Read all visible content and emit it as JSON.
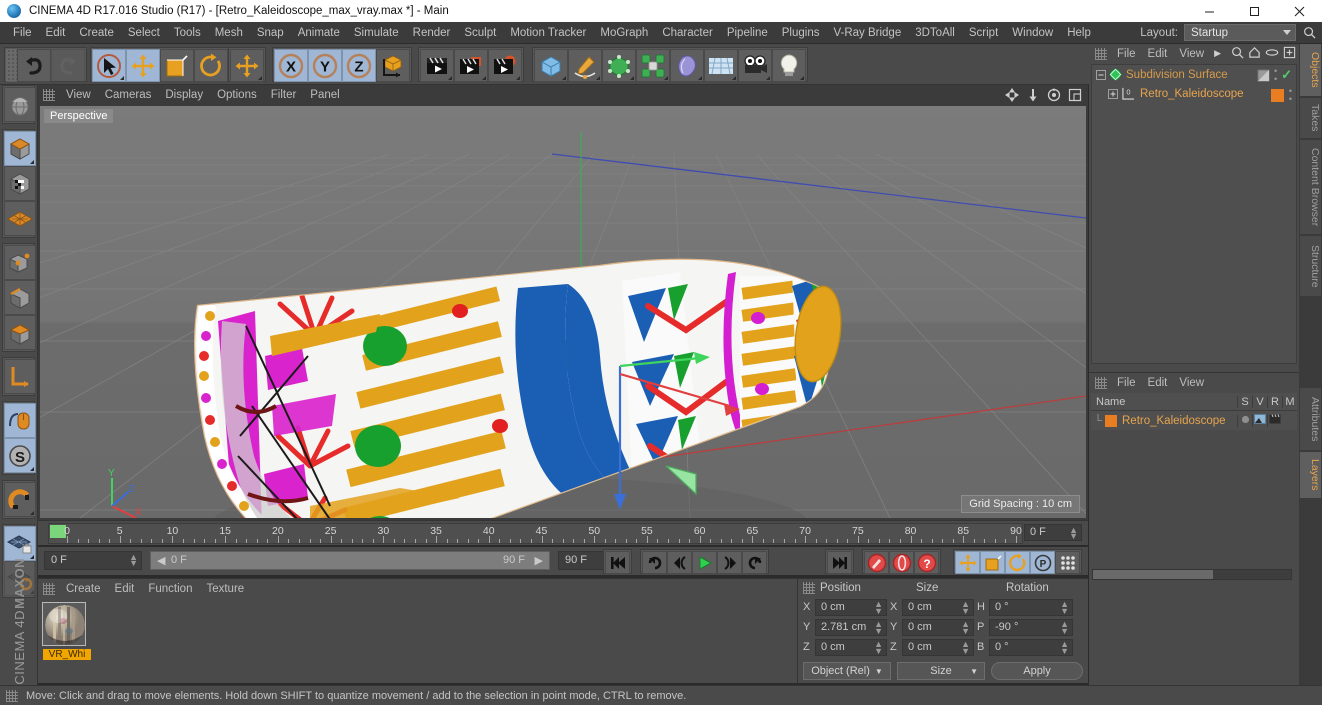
{
  "window": {
    "title": "CINEMA 4D R17.016 Studio (R17) - [Retro_Kaleidoscope_max_vray.max *] - Main",
    "app_icon": "c4d-logo-icon",
    "minimize": "—",
    "maximize": "❐",
    "close": "✕"
  },
  "menubar": {
    "items": [
      {
        "label": "File"
      },
      {
        "label": "Edit"
      },
      {
        "label": "Create"
      },
      {
        "label": "Select"
      },
      {
        "label": "Tools"
      },
      {
        "label": "Mesh"
      },
      {
        "label": "Snap"
      },
      {
        "label": "Animate"
      },
      {
        "label": "Simulate"
      },
      {
        "label": "Render"
      },
      {
        "label": "Sculpt"
      },
      {
        "label": "Motion Tracker"
      },
      {
        "label": "MoGraph"
      },
      {
        "label": "Character"
      },
      {
        "label": "Pipeline"
      },
      {
        "label": "Plugins"
      },
      {
        "label": "V-Ray Bridge"
      },
      {
        "label": "3DToAll"
      },
      {
        "label": "Script"
      },
      {
        "label": "Window"
      },
      {
        "label": "Help"
      }
    ],
    "layout_label": "Layout:",
    "layout_value": "Startup",
    "search_icon": "search-icon"
  },
  "toolbar": {
    "groups": [
      {
        "buttons": [
          {
            "name": "undo-button",
            "icon": "undo-arrow-icon",
            "state": "normal"
          },
          {
            "name": "redo-button",
            "icon": "redo-arrow-icon",
            "state": "disabled"
          }
        ]
      },
      {
        "buttons": [
          {
            "name": "live-selection-tool",
            "icon": "cursor-select-icon",
            "state": "active"
          },
          {
            "name": "move-tool",
            "icon": "move-arrows-icon",
            "state": "active"
          },
          {
            "name": "scale-tool",
            "icon": "scale-icon",
            "state": "normal"
          },
          {
            "name": "rotate-tool",
            "icon": "rotate-icon",
            "state": "normal"
          }
        ]
      },
      {
        "buttons": [
          {
            "name": "move-axis-tool",
            "icon": "move-arrows-icon",
            "state": "normal"
          }
        ]
      },
      {
        "buttons": [
          {
            "name": "lock-x-axis",
            "icon": "x-axis-icon",
            "state": "active",
            "letter": "X"
          },
          {
            "name": "lock-y-axis",
            "icon": "y-axis-icon",
            "state": "active",
            "letter": "Y"
          },
          {
            "name": "lock-z-axis",
            "icon": "z-axis-icon",
            "state": "active",
            "letter": "Z"
          },
          {
            "name": "world-object-coordinate-toggle",
            "icon": "world-axis-cube-icon",
            "state": "normal"
          }
        ]
      },
      {
        "buttons": [
          {
            "name": "render-view-button",
            "icon": "clapperboard-icon",
            "state": "normal"
          },
          {
            "name": "render-region-button",
            "icon": "clapperboard-region-icon",
            "state": "normal"
          },
          {
            "name": "render-settings-button",
            "icon": "clapperboard-gear-icon",
            "state": "normal"
          }
        ]
      },
      {
        "buttons": [
          {
            "name": "add-cube-button",
            "icon": "blue-cube-icon",
            "state": "normal"
          },
          {
            "name": "add-spline-button",
            "icon": "pen-spline-icon",
            "state": "normal"
          },
          {
            "name": "nurbs-generator-button",
            "icon": "green-cube-icon",
            "state": "normal"
          },
          {
            "name": "array-modeling-button",
            "icon": "green-cluster-icon",
            "state": "normal"
          },
          {
            "name": "deformer-button",
            "icon": "bend-deformer-icon",
            "state": "normal"
          },
          {
            "name": "environment-button",
            "icon": "floor-grid-icon",
            "state": "normal"
          },
          {
            "name": "add-camera-button",
            "icon": "camera-icon",
            "state": "normal"
          },
          {
            "name": "add-light-button",
            "icon": "light-bulb-icon",
            "state": "normal"
          }
        ]
      }
    ]
  },
  "left_toolbar": {
    "groups": [
      {
        "buttons": [
          {
            "name": "make-editable-button",
            "icon": "mesh-globe-icon",
            "state": "normal"
          }
        ]
      },
      {
        "buttons": [
          {
            "name": "model-mode-button",
            "icon": "model-cube-icon",
            "state": "active"
          },
          {
            "name": "texture-mode-button",
            "icon": "texture-cube-icon",
            "state": "normal"
          },
          {
            "name": "workplane-mode-button",
            "icon": "workplane-grid-icon",
            "state": "normal"
          }
        ]
      },
      {
        "buttons": [
          {
            "name": "point-mode-button",
            "icon": "point-cube-icon",
            "state": "normal"
          },
          {
            "name": "edge-mode-button",
            "icon": "edge-cube-icon",
            "state": "normal"
          },
          {
            "name": "polygon-mode-button",
            "icon": "polygon-cube-icon",
            "state": "normal"
          }
        ]
      },
      {
        "buttons": [
          {
            "name": "axis-mode-button",
            "icon": "axis-corner-icon",
            "state": "normal"
          }
        ]
      },
      {
        "buttons": [
          {
            "name": "enable-axis-modification",
            "icon": "mouse-axis-icon",
            "state": "active"
          },
          {
            "name": "soft-selection-button",
            "icon": "s-circle-icon",
            "state": "active"
          }
        ]
      },
      {
        "buttons": [
          {
            "name": "snap-magnet-button",
            "icon": "magnet-icon",
            "state": "normal"
          }
        ]
      },
      {
        "buttons": [
          {
            "name": "workplane-lock-button",
            "icon": "grid-lock-icon",
            "state": "active"
          },
          {
            "name": "workplane-rotate-button",
            "icon": "grid-rotate-icon",
            "state": "disabled"
          }
        ]
      }
    ],
    "brand_line1": "MAXON",
    "brand_line2": "CINEMA 4D"
  },
  "viewport": {
    "menu": [
      {
        "label": "View"
      },
      {
        "label": "Cameras"
      },
      {
        "label": "Display"
      },
      {
        "label": "Options"
      },
      {
        "label": "Filter"
      },
      {
        "label": "Panel"
      }
    ],
    "nav_icons": [
      "pan-icon",
      "dolly-icon",
      "orbit-icon",
      "maximize-viewport-icon"
    ],
    "perspective_label": "Perspective",
    "grid_spacing_label": "Grid Spacing : 10 cm",
    "object_description": "retro kaleidoscope cylinder with colorful striped pattern"
  },
  "timeline": {
    "ticks": [
      0,
      5,
      10,
      15,
      20,
      25,
      30,
      35,
      40,
      45,
      50,
      55,
      60,
      65,
      70,
      75,
      80,
      85,
      90
    ],
    "current_frame_field": "0 F",
    "playhead_frame": 0,
    "min_frame": 0,
    "max_frame": 90
  },
  "playback": {
    "current_frame": "0 F",
    "scrub_start": "0 F",
    "scrub_end": "90 F",
    "end_frame": "90 F",
    "buttons": [
      {
        "name": "go-to-start-button",
        "icon": "skip-start-icon",
        "state": "normal"
      },
      {
        "name": "previous-keyframe-button",
        "icon": "rewind-loop-icon",
        "state": "normal"
      },
      {
        "name": "previous-frame-button",
        "icon": "step-back-icon",
        "state": "normal"
      },
      {
        "name": "play-button",
        "icon": "play-triangle-icon",
        "state": "normal"
      },
      {
        "name": "next-frame-button",
        "icon": "step-forward-icon",
        "state": "normal"
      },
      {
        "name": "next-keyframe-button",
        "icon": "forward-loop-icon",
        "state": "normal"
      },
      {
        "name": "go-to-end-button",
        "icon": "skip-end-icon",
        "state": "normal"
      }
    ],
    "record_buttons": [
      {
        "name": "record-active-objects-button",
        "icon": "record-key-icon",
        "state": "normal"
      },
      {
        "name": "autokeying-button",
        "icon": "autokey-circle-icon",
        "state": "normal"
      },
      {
        "name": "keyframe-selection-button",
        "icon": "question-mark-icon",
        "state": "normal"
      }
    ],
    "key_toggles": [
      {
        "name": "record-position-button",
        "icon": "move-arrows-icon",
        "state": "active"
      },
      {
        "name": "record-scale-button",
        "icon": "scale-icon",
        "state": "active"
      },
      {
        "name": "record-rotation-button",
        "icon": "rotate-icon",
        "state": "active"
      },
      {
        "name": "record-parameter-button",
        "icon": "p-circle-icon",
        "state": "active"
      },
      {
        "name": "record-pla-button",
        "icon": "point-level-anim-icon",
        "state": "normal"
      }
    ],
    "timeline_toggle": {
      "name": "timeline-view-button",
      "icon": "timeline-strip-icon",
      "state": "active"
    }
  },
  "material_manager": {
    "menu": [
      {
        "label": "Create"
      },
      {
        "label": "Edit"
      },
      {
        "label": "Function"
      },
      {
        "label": "Texture"
      }
    ],
    "materials": [
      {
        "name": "VR_Whi",
        "swatch": "kaleidoscope-texture-sphere"
      }
    ]
  },
  "coordinates": {
    "headers": [
      "Position",
      "Size",
      "Rotation"
    ],
    "rows": [
      {
        "pos_label": "X",
        "pos_value": "0 cm",
        "size_label": "X",
        "size_value": "0 cm",
        "rot_label": "H",
        "rot_value": "0 °"
      },
      {
        "pos_label": "Y",
        "pos_value": "2.781 cm",
        "size_label": "Y",
        "size_value": "0 cm",
        "rot_label": "P",
        "rot_value": "-90 °"
      },
      {
        "pos_label": "Z",
        "pos_value": "0 cm",
        "size_label": "Z",
        "size_value": "0 cm",
        "rot_label": "B",
        "rot_value": "0 °"
      }
    ],
    "coord_system": "Object (Rel)",
    "size_mode": "Size",
    "apply_label": "Apply"
  },
  "object_manager": {
    "menu": [
      {
        "label": "File"
      },
      {
        "label": "Edit"
      },
      {
        "label": "View"
      }
    ],
    "toolbar_icons": [
      "chevron-right-icon",
      "search-icon",
      "home-icon",
      "link-icon",
      "new-layer-icon"
    ],
    "items": [
      {
        "name": "Subdivision Surface",
        "icon": "subdivision-surface-icon",
        "selected": false,
        "check": "✓"
      },
      {
        "name": "Retro_Kaleidoscope",
        "icon": "polygon-object-icon",
        "selected": true,
        "badge": "0"
      }
    ]
  },
  "attributes_panel": {
    "menu": [
      {
        "label": "File"
      },
      {
        "label": "Edit"
      },
      {
        "label": "View"
      }
    ],
    "columns": [
      "Name",
      "S",
      "V",
      "R",
      "M"
    ],
    "rows": [
      {
        "name": "Retro_Kaleidoscope",
        "icon": "orange-layer-icon"
      }
    ]
  },
  "right_tabs": [
    {
      "label": "Objects",
      "active": true
    },
    {
      "label": "Takes",
      "active": false
    },
    {
      "label": "Content Browser",
      "active": false
    },
    {
      "label": "Structure",
      "active": false
    }
  ],
  "right_tabs_lower": [
    {
      "label": "Attributes",
      "active": false
    },
    {
      "label": "Layers",
      "active": true
    }
  ],
  "statusbar": {
    "text": "Move: Click and drag to move elements. Hold down SHIFT to quantize movement / add to the selection in point mode, CTRL to remove."
  },
  "colors": {
    "accent_orange": "#e8a44e",
    "panel_bg": "#4a4a4a",
    "viewport_bg": "#6e6e6e",
    "active_blue": "#9fb7d4",
    "titlebar_bg": "#ffffff"
  }
}
